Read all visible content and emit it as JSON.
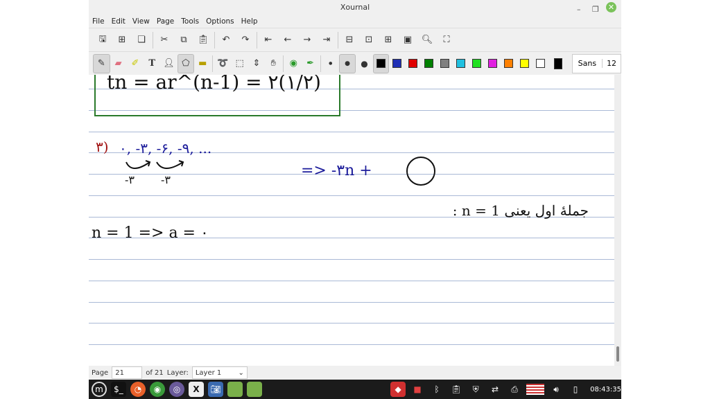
{
  "window": {
    "title": "Xournal"
  },
  "menu": [
    "File",
    "Edit",
    "View",
    "Page",
    "Tools",
    "Options",
    "Help"
  ],
  "toolbar1": [
    "save",
    "new-page",
    "duplicate",
    "cut",
    "copy",
    "paste",
    "undo",
    "redo",
    "first-page",
    "prev-page",
    "next-page",
    "last-page",
    "zoom-out",
    "zoom-fit",
    "zoom-in",
    "zoom-100",
    "find",
    "fullscreen"
  ],
  "toolbar2": {
    "font_name": "Sans",
    "font_size": "12",
    "colors": [
      "#000000",
      "#1f2fb5",
      "#e00000",
      "#008000",
      "#808080",
      "#20c0e0",
      "#20e020",
      "#e020e0",
      "#ff8000",
      "#ffff00",
      "#ffffff"
    ],
    "current_color": "#000000"
  },
  "page_content": {
    "formula": "tn = ar^(n-1) = ۲(۱/۲)",
    "item3_label": "۳)",
    "sequence": "۰, -۳, -۶, -۹, ...",
    "diff1": "-۳",
    "diff2": "-۳",
    "general": "=> -۳n +",
    "note_fa": "جملهٔ اول یعنی n = 1 :",
    "n1": "n = 1  =>  a = ۰"
  },
  "status": {
    "page_label": "Page",
    "page": "21",
    "of": "of 21",
    "layer_label": "Layer:",
    "layer": "Layer 1"
  },
  "taskbar": {
    "clock": "08:43:35"
  }
}
